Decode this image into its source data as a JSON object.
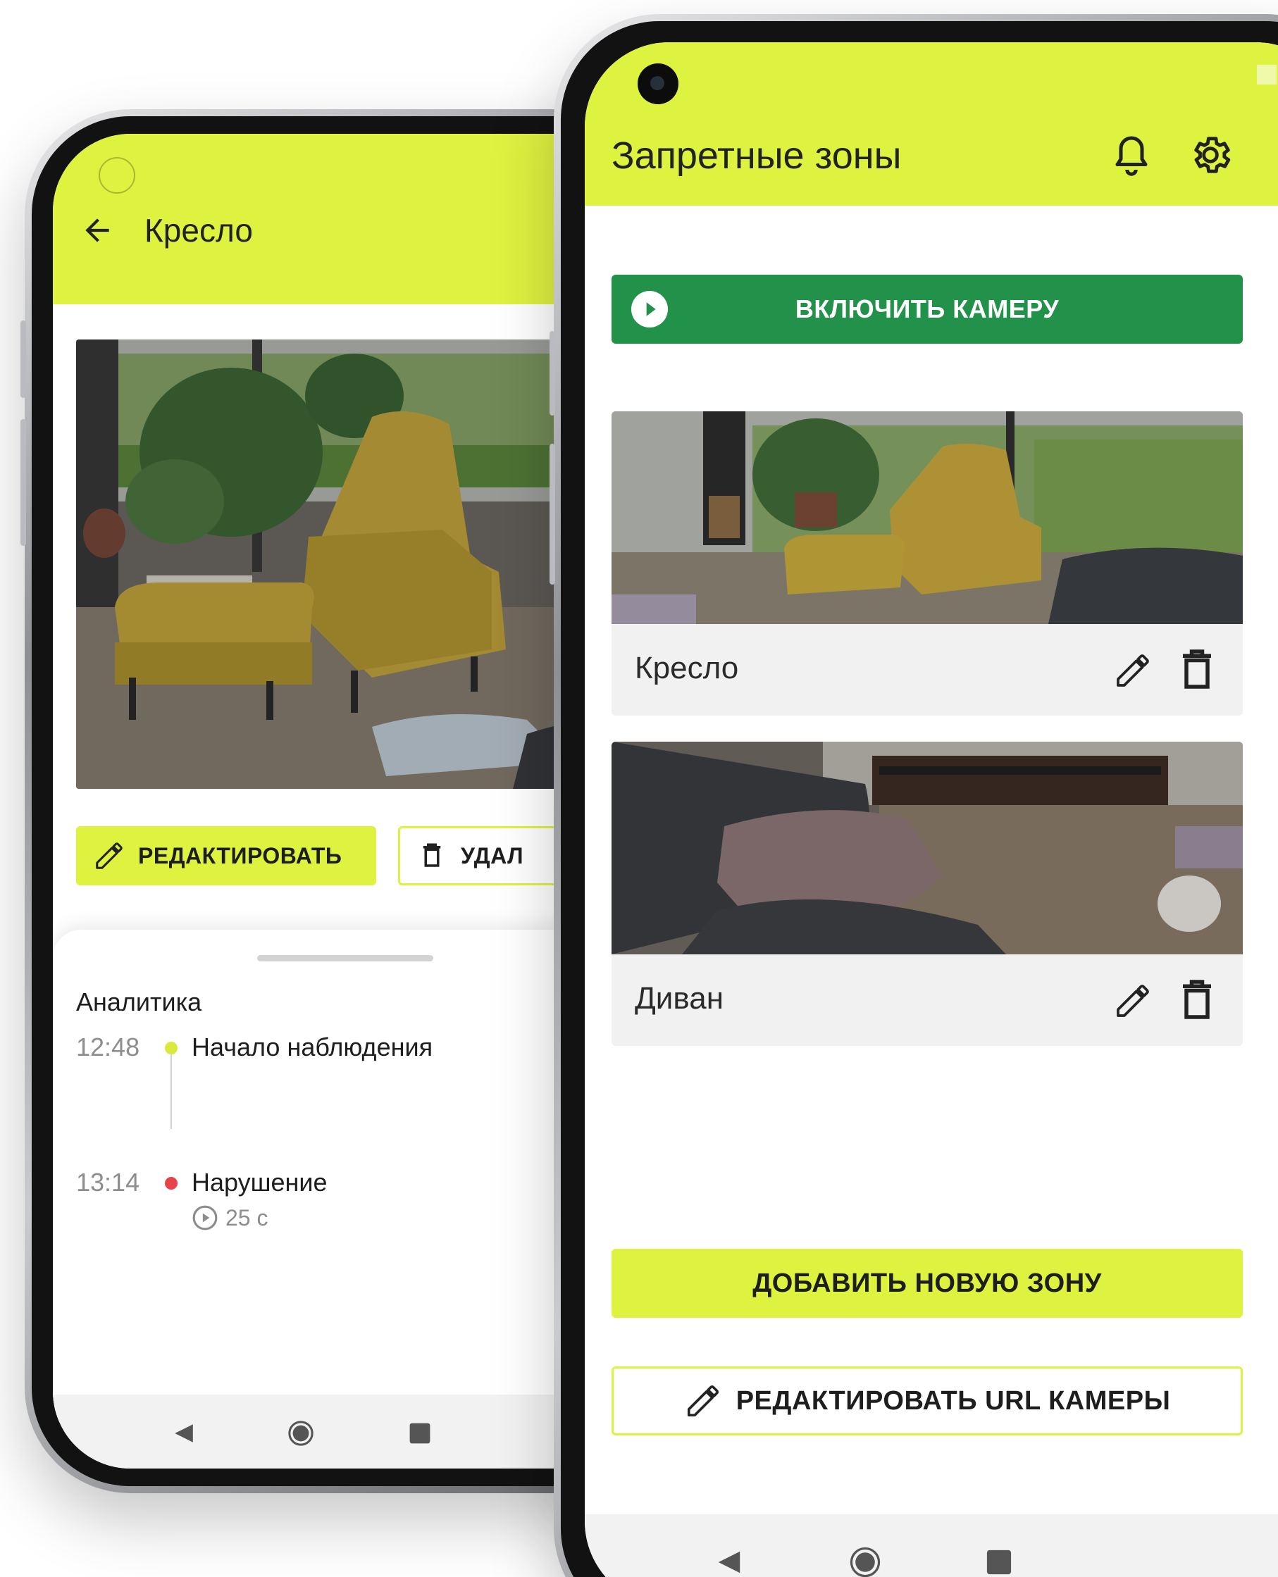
{
  "back_screen": {
    "title": "Кресло",
    "edit_button": "РЕДАКТИРОВАТЬ",
    "delete_button": "УДАЛ",
    "analytics": {
      "title": "Аналитика",
      "events": [
        {
          "time": "12:48",
          "label": "Начало наблюдения",
          "status_color": "#d7ea3a"
        },
        {
          "time": "13:14",
          "label": "Нарушение",
          "status_color": "#e8434b",
          "duration": "25 с"
        }
      ]
    }
  },
  "front_screen": {
    "title": "Запретные зоны",
    "camera_button": "ВКЛЮЧИТЬ КАМЕРУ",
    "zones": [
      {
        "name": "Кресло"
      },
      {
        "name": "Диван"
      }
    ],
    "add_zone_button": "ДОБАВИТЬ НОВУЮ ЗОНУ",
    "edit_url_button": "РЕДАКТИРОВАТЬ URL КАМЕРЫ"
  },
  "colors": {
    "accent": "#def240",
    "camera_button": "#22924a",
    "violation": "#e8434b"
  }
}
